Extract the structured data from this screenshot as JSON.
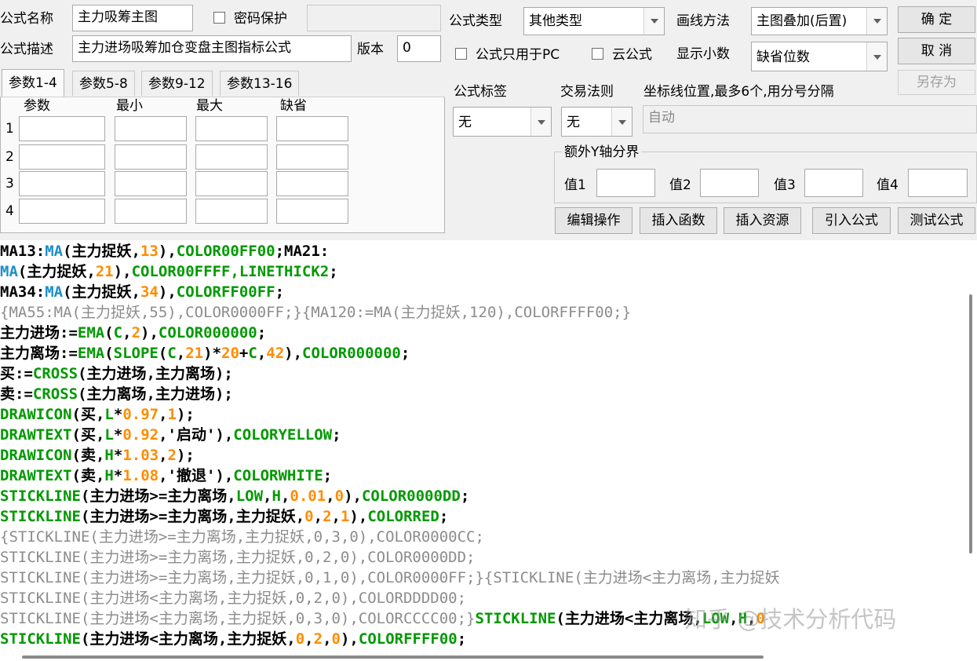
{
  "form": {
    "name_label": "公式名称",
    "name_value": "主力吸筹主图",
    "password_label": "密码保护",
    "password_value": "",
    "desc_label": "公式描述",
    "desc_value": "主力进场吸筹加仓变盘主图指标公式",
    "version_label": "版本",
    "version_value": "0",
    "type_label": "公式类型",
    "type_value": "其他类型",
    "draw_label": "画线方法",
    "draw_value": "主图叠加(后置)",
    "pc_only_label": "公式只用于PC",
    "cloud_label": "云公式",
    "decimals_label": "显示小数",
    "decimals_value": "缺省位数",
    "tag_label": "公式标签",
    "tag_value": "无",
    "rule_label": "交易法则",
    "rule_value": "无",
    "coord_label": "坐标线位置,最多6个,用分号分隔",
    "coord_value": "自动",
    "extra_y_label": "额外Y轴分界",
    "v1_label": "值1",
    "v2_label": "值2",
    "v3_label": "值3",
    "v4_label": "值4"
  },
  "buttons": {
    "ok": "确 定",
    "cancel": "取 消",
    "save_as": "另存为",
    "edit": "编辑操作",
    "insert_func": "插入函数",
    "insert_res": "插入资源",
    "import": "引入公式",
    "test": "测试公式"
  },
  "params": {
    "tabs": [
      "参数1-4",
      "参数5-8",
      "参数9-12",
      "参数13-16"
    ],
    "headers": [
      "参数",
      "最小",
      "最大",
      "缺省"
    ],
    "rows": [
      "1",
      "2",
      "3",
      "4"
    ]
  },
  "colors": {
    "keyword": "#000000",
    "function": "#1a8fc8",
    "green_function": "#009900",
    "number": "#ff8c00",
    "comment": "#8c8c8c"
  },
  "code_lines": [
    [
      [
        "k",
        "MA13:"
      ],
      [
        "f",
        "MA"
      ],
      [
        "k",
        "(主力捉妖,"
      ],
      [
        "n",
        "13"
      ],
      [
        "k",
        "),"
      ],
      [
        "g",
        "COLOR00FF00"
      ],
      [
        "k",
        ";MA21:"
      ]
    ],
    [
      [
        "f",
        "MA"
      ],
      [
        "k",
        "(主力捉妖,"
      ],
      [
        "n",
        "21"
      ],
      [
        "k",
        "),"
      ],
      [
        "g",
        "COLOR00FFFF,LINETHICK2"
      ],
      [
        "k",
        ";"
      ]
    ],
    [
      [
        "k",
        "MA34:"
      ],
      [
        "f",
        "MA"
      ],
      [
        "k",
        "(主力捉妖,"
      ],
      [
        "n",
        "34"
      ],
      [
        "k",
        "),"
      ],
      [
        "g",
        "COLORFF00FF"
      ],
      [
        "k",
        ";"
      ]
    ],
    [
      [
        "c",
        "{MA55:MA(主力捉妖,55),COLOR0000FF;}{MA120:=MA(主力捉妖,120),COLORFFFF00;}"
      ]
    ],
    [
      [
        "k",
        "主力进场:="
      ],
      [
        "g",
        "EMA"
      ],
      [
        "k",
        "("
      ],
      [
        "g",
        "C"
      ],
      [
        "k",
        ","
      ],
      [
        "n",
        "2"
      ],
      [
        "k",
        "),"
      ],
      [
        "g",
        "COLOR000000"
      ],
      [
        "k",
        ";"
      ]
    ],
    [
      [
        "k",
        "主力离场:="
      ],
      [
        "g",
        "EMA"
      ],
      [
        "k",
        "("
      ],
      [
        "g",
        "SLOPE"
      ],
      [
        "k",
        "("
      ],
      [
        "g",
        "C"
      ],
      [
        "k",
        ","
      ],
      [
        "n",
        "21"
      ],
      [
        "k",
        ")*"
      ],
      [
        "n",
        "20"
      ],
      [
        "k",
        "+"
      ],
      [
        "g",
        "C"
      ],
      [
        "k",
        ","
      ],
      [
        "n",
        "42"
      ],
      [
        "k",
        "),"
      ],
      [
        "g",
        "COLOR000000"
      ],
      [
        "k",
        ";"
      ]
    ],
    [
      [
        "k",
        "买:="
      ],
      [
        "g",
        "CROSS"
      ],
      [
        "k",
        "(主力进场,主力离场);"
      ]
    ],
    [
      [
        "k",
        "卖:="
      ],
      [
        "g",
        "CROSS"
      ],
      [
        "k",
        "(主力离场,主力进场);"
      ]
    ],
    [
      [
        "g",
        "DRAWICON"
      ],
      [
        "k",
        "(买,"
      ],
      [
        "g",
        "L"
      ],
      [
        "k",
        "*"
      ],
      [
        "n",
        "0.97"
      ],
      [
        "k",
        ","
      ],
      [
        "n",
        "1"
      ],
      [
        "k",
        ");"
      ]
    ],
    [
      [
        "g",
        "DRAWTEXT"
      ],
      [
        "k",
        "(买,"
      ],
      [
        "g",
        "L"
      ],
      [
        "k",
        "*"
      ],
      [
        "n",
        "0.92"
      ],
      [
        "k",
        ",'启动'),"
      ],
      [
        "g",
        "COLORYELLOW"
      ],
      [
        "k",
        ";"
      ]
    ],
    [
      [
        "g",
        "DRAWICON"
      ],
      [
        "k",
        "(卖,"
      ],
      [
        "g",
        "H"
      ],
      [
        "k",
        "*"
      ],
      [
        "n",
        "1.03"
      ],
      [
        "k",
        ","
      ],
      [
        "n",
        "2"
      ],
      [
        "k",
        ");"
      ]
    ],
    [
      [
        "g",
        "DRAWTEXT"
      ],
      [
        "k",
        "(卖,"
      ],
      [
        "g",
        "H"
      ],
      [
        "k",
        "*"
      ],
      [
        "n",
        "1.08"
      ],
      [
        "k",
        ",'撤退'),"
      ],
      [
        "g",
        "COLORWHITE"
      ],
      [
        "k",
        ";"
      ]
    ],
    [
      [
        "g",
        "STICKLINE"
      ],
      [
        "k",
        "(主力进场>=主力离场,"
      ],
      [
        "g",
        "LOW"
      ],
      [
        "k",
        ","
      ],
      [
        "g",
        "H"
      ],
      [
        "k",
        ","
      ],
      [
        "n",
        "0.01"
      ],
      [
        "k",
        ","
      ],
      [
        "n",
        "0"
      ],
      [
        "k",
        "),"
      ],
      [
        "g",
        "COLOR0000DD"
      ],
      [
        "k",
        ";"
      ]
    ],
    [
      [
        "g",
        "STICKLINE"
      ],
      [
        "k",
        "(主力进场>=主力离场,主力捉妖,"
      ],
      [
        "n",
        "0"
      ],
      [
        "k",
        ","
      ],
      [
        "n",
        "2"
      ],
      [
        "k",
        ","
      ],
      [
        "n",
        "1"
      ],
      [
        "k",
        "),"
      ],
      [
        "g",
        "COLORRED"
      ],
      [
        "k",
        ";"
      ]
    ],
    [
      [
        "c",
        "{STICKLINE(主力进场>=主力离场,主力捉妖,0,3,0),COLOR0000CC;"
      ]
    ],
    [
      [
        "c",
        "STICKLINE(主力进场>=主力离场,主力捉妖,0,2,0),COLOR0000DD;"
      ]
    ],
    [
      [
        "c",
        "STICKLINE(主力进场>=主力离场,主力捉妖,0,1,0),COLOR0000FF;}{STICKLINE(主力进场<主力离场,主力捉妖"
      ]
    ],
    [
      [
        "c",
        "STICKLINE(主力进场<主力离场,主力捉妖,0,2,0),COLORDDDD00;"
      ]
    ],
    [
      [
        "c",
        "STICKLINE(主力进场<主力离场,主力捉妖,0,3,0),COLORCCCC00;}"
      ],
      [
        "g",
        "STICKLINE"
      ],
      [
        "k",
        "(主力进场<主力离场,"
      ],
      [
        "g",
        "LOW"
      ],
      [
        "k",
        ","
      ],
      [
        "g",
        "H"
      ],
      [
        "k",
        ","
      ],
      [
        "n",
        "0"
      ]
    ],
    [
      [
        "g",
        "STICKLINE"
      ],
      [
        "k",
        "(主力进场<主力离场,主力捉妖,"
      ],
      [
        "n",
        "0"
      ],
      [
        "k",
        ","
      ],
      [
        "n",
        "2"
      ],
      [
        "k",
        ","
      ],
      [
        "n",
        "0"
      ],
      [
        "k",
        "),"
      ],
      [
        "g",
        "COLORFFFF00"
      ],
      [
        "k",
        ";"
      ]
    ]
  ],
  "watermark": "知乎 @技术分析代码"
}
